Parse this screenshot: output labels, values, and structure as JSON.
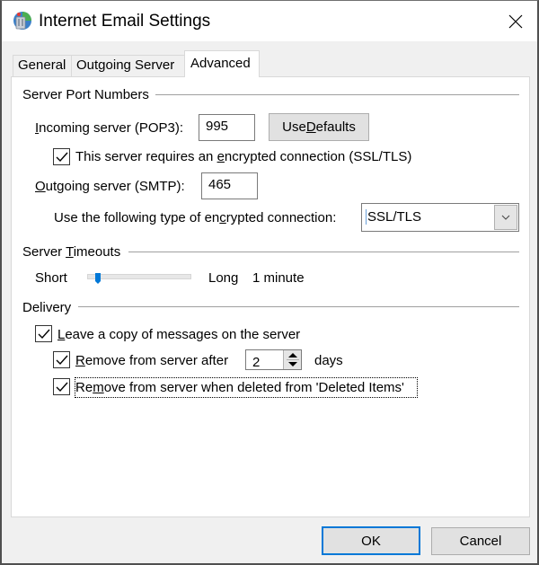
{
  "window": {
    "title": "Internet Email Settings",
    "icon": "email-settings-icon",
    "close_icon": "close-icon"
  },
  "tabs": [
    {
      "label": "General",
      "active": false
    },
    {
      "label": "Outgoing Server",
      "active": false
    },
    {
      "label": "Advanced",
      "active": true
    }
  ],
  "server_ports": {
    "group_label": "Server Port Numbers",
    "incoming_label_u": "I",
    "incoming_label_rest": "ncoming server (POP3):",
    "incoming_value": "995",
    "use_defaults_pre": "Use ",
    "use_defaults_u": "D",
    "use_defaults_rest": "efaults",
    "ssl_checkbox_checked": true,
    "ssl_label_pre": "This server requires an ",
    "ssl_label_u": "e",
    "ssl_label_rest": "ncrypted connection (SSL/TLS)",
    "outgoing_label_u": "O",
    "outgoing_label_rest": "utgoing server (SMTP):",
    "outgoing_value": "465",
    "encryption_label_pre": "Use the following type of en",
    "encryption_label_u": "c",
    "encryption_label_rest": "rypted connection:",
    "encryption_value": "SSL/TLS"
  },
  "timeouts": {
    "group_label_pre": "Server ",
    "group_label_u": "T",
    "group_label_rest": "imeouts",
    "short_label": "Short",
    "long_label": "Long",
    "value_text": "1 minute",
    "slider_fraction": 0.07
  },
  "delivery": {
    "group_label": "Delivery",
    "leave_copy_checked": true,
    "leave_copy_u": "L",
    "leave_copy_rest": "eave a copy of messages on the server",
    "remove_after_checked": true,
    "remove_after_u": "R",
    "remove_after_rest": "emove from server after",
    "remove_after_days": "2",
    "days_label": "days",
    "remove_deleted_checked": true,
    "remove_deleted_pre": "Re",
    "remove_deleted_u": "m",
    "remove_deleted_rest": "ove from server when deleted from 'Deleted Items'"
  },
  "footer": {
    "ok_label": "OK",
    "cancel_label": "Cancel"
  },
  "colors": {
    "accent": "#0078d7",
    "panel_bg": "#ffffff",
    "window_bg": "#f0f0f0"
  }
}
